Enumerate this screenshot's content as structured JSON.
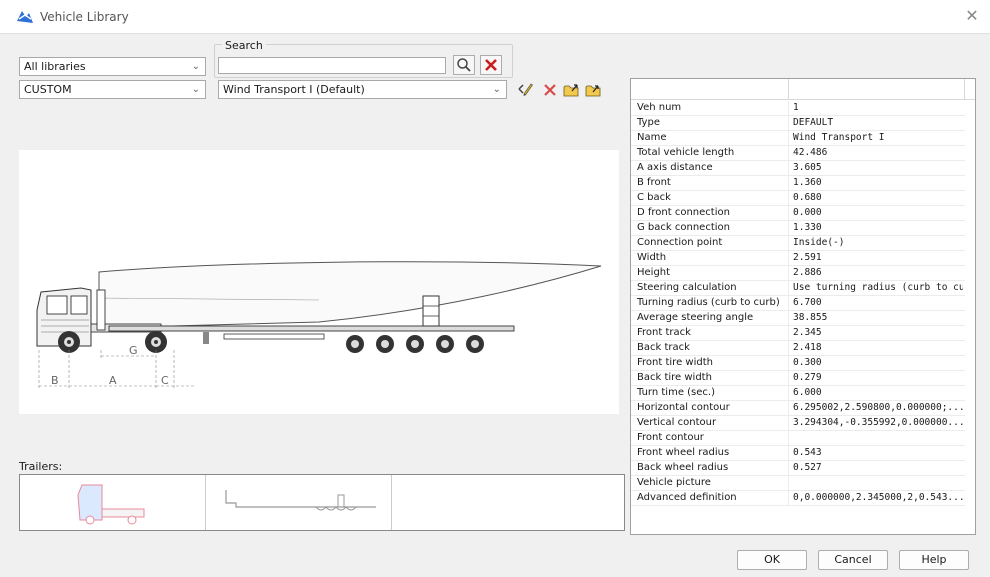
{
  "window": {
    "title": "Vehicle Library"
  },
  "search": {
    "label": "Search",
    "value": ""
  },
  "library_combo": {
    "selected": "All libraries"
  },
  "category_combo": {
    "selected": "CUSTOM"
  },
  "vehicle_combo": {
    "selected": "Wind Transport I (Default)"
  },
  "drawing": {
    "dimension_labels": [
      "B",
      "A",
      "G",
      "C"
    ]
  },
  "trailers": {
    "label": "Trailers:"
  },
  "properties": [
    {
      "key": "Veh num",
      "value": "1"
    },
    {
      "key": "Type",
      "value": "DEFAULT"
    },
    {
      "key": "Name",
      "value": "Wind Transport I"
    },
    {
      "key": "Total vehicle length",
      "value": "42.486"
    },
    {
      "key": "A axis distance",
      "value": "3.605"
    },
    {
      "key": "B front",
      "value": "1.360"
    },
    {
      "key": "C back",
      "value": "0.680"
    },
    {
      "key": "D front connection",
      "value": "0.000"
    },
    {
      "key": "G back connection",
      "value": "1.330"
    },
    {
      "key": "Connection point",
      "value": "Inside(-)"
    },
    {
      "key": "Width",
      "value": "2.591"
    },
    {
      "key": "Height",
      "value": "2.886"
    },
    {
      "key": "Steering calculation",
      "value": "Use turning radius (curb to curb)"
    },
    {
      "key": "Turning radius (curb to curb)",
      "value": "6.700"
    },
    {
      "key": "Average steering angle",
      "value": "38.855"
    },
    {
      "key": "Front track",
      "value": "2.345"
    },
    {
      "key": "Back track",
      "value": "2.418"
    },
    {
      "key": "Front tire width",
      "value": "0.300"
    },
    {
      "key": "Back tire width",
      "value": "0.279"
    },
    {
      "key": "Turn time (sec.)",
      "value": "6.000"
    },
    {
      "key": "Horizontal contour",
      "value": "6.295002,2.590800,0.000000;..."
    },
    {
      "key": "Vertical contour",
      "value": "3.294304,-0.355992,0.000000..."
    },
    {
      "key": "Front contour",
      "value": ""
    },
    {
      "key": "Front wheel radius",
      "value": "0.543"
    },
    {
      "key": "Back wheel radius",
      "value": "0.527"
    },
    {
      "key": "Vehicle picture",
      "value": ""
    },
    {
      "key": "Advanced definition",
      "value": "0,0.000000,2.345000,2,0.543..."
    }
  ],
  "buttons": {
    "ok": "OK",
    "cancel": "Cancel",
    "help": "Help"
  },
  "colors": {
    "accent_delete": "#cc1b1b",
    "icon_blue": "#2f6fd6",
    "trailer_preview": "#e88a9a"
  }
}
